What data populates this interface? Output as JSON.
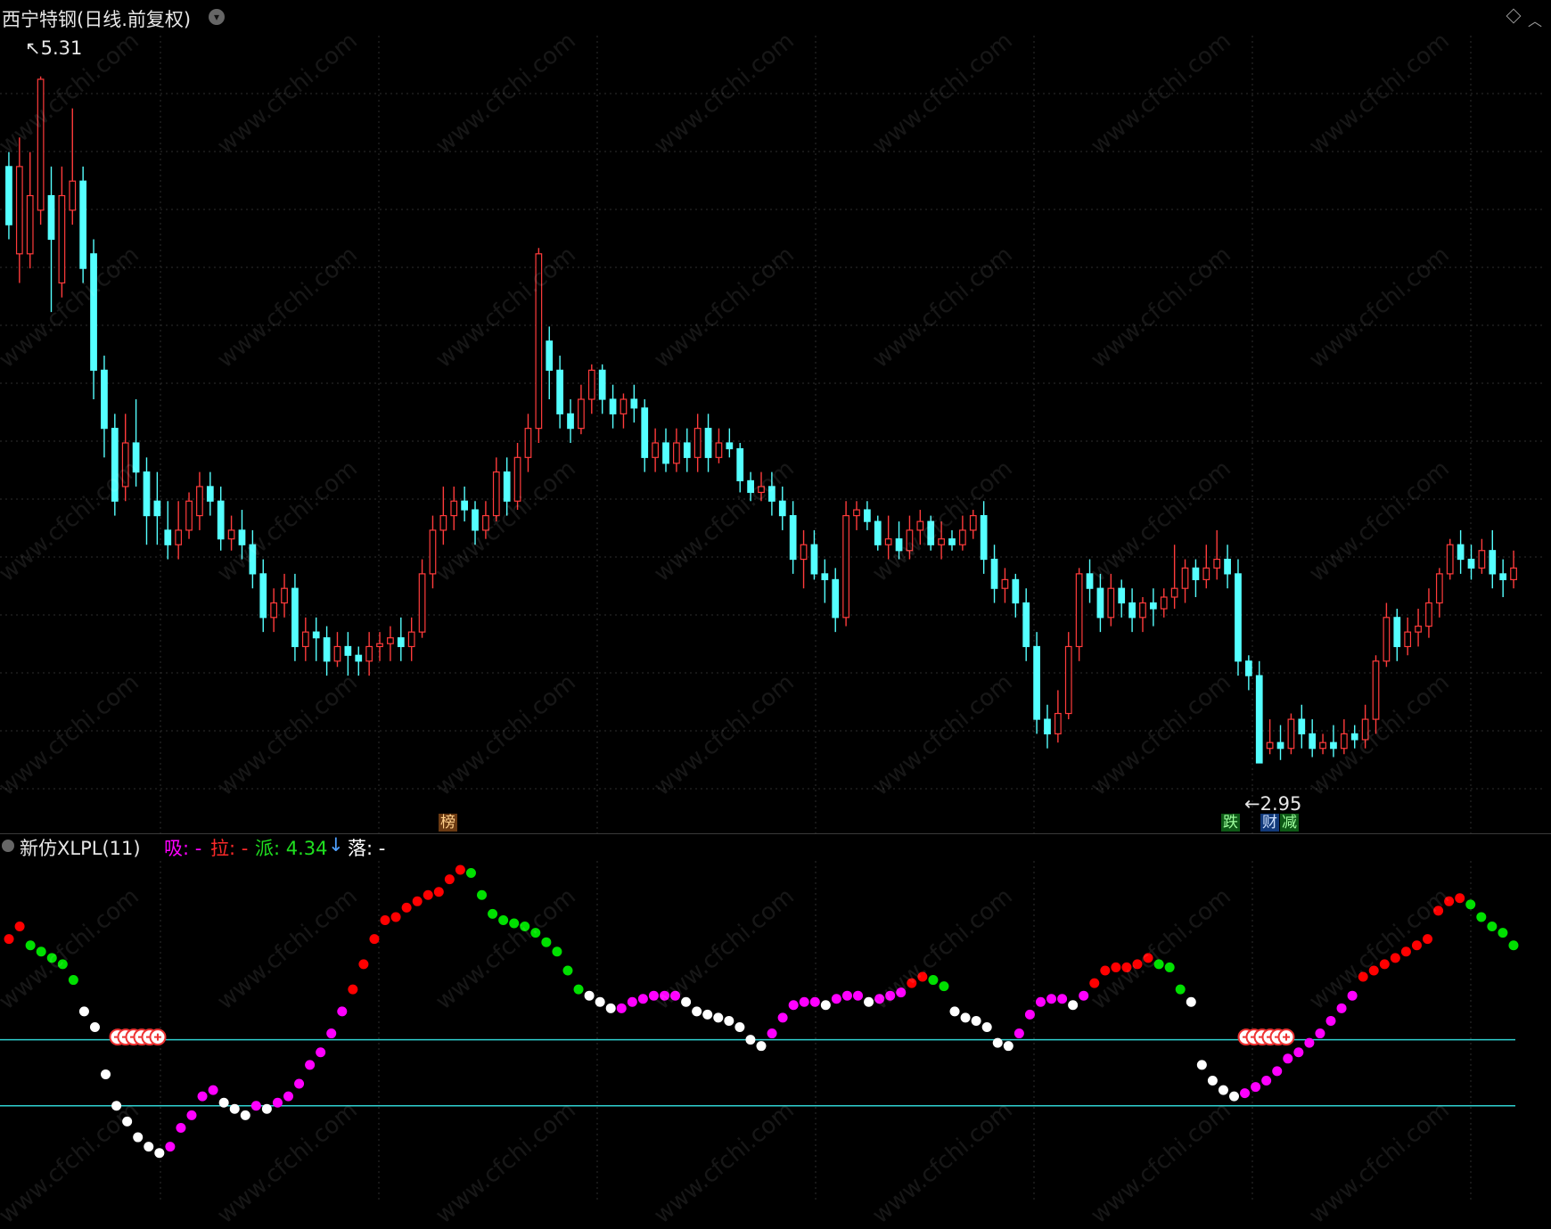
{
  "header": {
    "title": "西宁特钢(日线.前复权)"
  },
  "main_chart": {
    "high_label": "5.31",
    "low_label": "2.95",
    "tags": [
      {
        "text": "榜",
        "kind": "bang"
      },
      {
        "text": "跌",
        "kind": "die"
      },
      {
        "text": "财",
        "kind": "cai"
      },
      {
        "text": "减",
        "kind": "jian"
      }
    ],
    "watermark": "www.cfchi.com"
  },
  "indicator": {
    "name": "新仿XLPL(11)",
    "xi_label": "吸: -",
    "la_label": "拉: -",
    "pai_label": "派: 4.34",
    "pai_arrow": "↓",
    "luo_label": "落: -"
  },
  "colors": {
    "up": "#ff3b3b",
    "down": "#54ffff",
    "xi": "#ff00ff",
    "la": "#ff0000",
    "pai": "#00e000",
    "luo": "#ffffff",
    "grid": "#2e2e2e",
    "hline": "#2fd0d0"
  },
  "chart_data": {
    "type": "candlestick",
    "y_range": [
      2.8,
      5.45
    ],
    "candles": [
      [
        5.0,
        4.8,
        5.05,
        4.75
      ],
      [
        4.7,
        5.0,
        5.1,
        4.6
      ],
      [
        4.7,
        4.9,
        5.05,
        4.65
      ],
      [
        4.85,
        5.3,
        5.31,
        4.8
      ],
      [
        4.9,
        4.75,
        5.0,
        4.5
      ],
      [
        4.6,
        4.9,
        5.0,
        4.55
      ],
      [
        4.85,
        4.95,
        5.2,
        4.8
      ],
      [
        4.95,
        4.65,
        5.0,
        4.6
      ],
      [
        4.7,
        4.3,
        4.75,
        4.2
      ],
      [
        4.3,
        4.1,
        4.35,
        4.0
      ],
      [
        4.1,
        3.85,
        4.15,
        3.8
      ],
      [
        3.9,
        4.05,
        4.15,
        3.85
      ],
      [
        4.05,
        3.95,
        4.2,
        3.9
      ],
      [
        3.95,
        3.8,
        4.0,
        3.7
      ],
      [
        3.85,
        3.8,
        3.95,
        3.7
      ],
      [
        3.75,
        3.7,
        3.85,
        3.65
      ],
      [
        3.7,
        3.75,
        3.85,
        3.65
      ],
      [
        3.75,
        3.85,
        3.88,
        3.72
      ],
      [
        3.8,
        3.9,
        3.95,
        3.75
      ],
      [
        3.9,
        3.85,
        3.95,
        3.8
      ],
      [
        3.85,
        3.72,
        3.9,
        3.68
      ],
      [
        3.72,
        3.75,
        3.8,
        3.68
      ],
      [
        3.75,
        3.7,
        3.82,
        3.65
      ],
      [
        3.7,
        3.6,
        3.75,
        3.55
      ],
      [
        3.6,
        3.45,
        3.65,
        3.4
      ],
      [
        3.45,
        3.5,
        3.55,
        3.4
      ],
      [
        3.5,
        3.55,
        3.6,
        3.45
      ],
      [
        3.55,
        3.35,
        3.6,
        3.3
      ],
      [
        3.35,
        3.4,
        3.45,
        3.3
      ],
      [
        3.4,
        3.38,
        3.45,
        3.3
      ],
      [
        3.38,
        3.3,
        3.42,
        3.25
      ],
      [
        3.3,
        3.35,
        3.4,
        3.28
      ],
      [
        3.35,
        3.32,
        3.4,
        3.25
      ],
      [
        3.32,
        3.3,
        3.35,
        3.25
      ],
      [
        3.3,
        3.35,
        3.4,
        3.25
      ],
      [
        3.35,
        3.36,
        3.4,
        3.3
      ],
      [
        3.36,
        3.38,
        3.42,
        3.3
      ],
      [
        3.38,
        3.35,
        3.45,
        3.3
      ],
      [
        3.35,
        3.4,
        3.45,
        3.3
      ],
      [
        3.4,
        3.6,
        3.65,
        3.38
      ],
      [
        3.6,
        3.75,
        3.8,
        3.55
      ],
      [
        3.75,
        3.8,
        3.9,
        3.7
      ],
      [
        3.8,
        3.85,
        3.9,
        3.75
      ],
      [
        3.85,
        3.82,
        3.9,
        3.78
      ],
      [
        3.82,
        3.75,
        3.85,
        3.7
      ],
      [
        3.75,
        3.8,
        3.85,
        3.72
      ],
      [
        3.8,
        3.95,
        4.0,
        3.78
      ],
      [
        3.95,
        3.85,
        4.0,
        3.8
      ],
      [
        3.85,
        4.0,
        4.05,
        3.82
      ],
      [
        4.0,
        4.1,
        4.15,
        3.95
      ],
      [
        4.1,
        4.7,
        4.72,
        4.05
      ],
      [
        4.4,
        4.3,
        4.45,
        4.2
      ],
      [
        4.3,
        4.15,
        4.35,
        4.1
      ],
      [
        4.15,
        4.1,
        4.2,
        4.05
      ],
      [
        4.1,
        4.2,
        4.25,
        4.08
      ],
      [
        4.2,
        4.3,
        4.32,
        4.15
      ],
      [
        4.3,
        4.2,
        4.32,
        4.15
      ],
      [
        4.2,
        4.15,
        4.25,
        4.1
      ],
      [
        4.15,
        4.2,
        4.22,
        4.1
      ],
      [
        4.2,
        4.17,
        4.25,
        4.12
      ],
      [
        4.17,
        4.0,
        4.2,
        3.95
      ],
      [
        4.0,
        4.05,
        4.1,
        3.95
      ],
      [
        4.05,
        3.98,
        4.1,
        3.95
      ],
      [
        3.98,
        4.05,
        4.1,
        3.95
      ],
      [
        4.05,
        4.0,
        4.1,
        3.95
      ],
      [
        4.0,
        4.1,
        4.15,
        3.95
      ],
      [
        4.1,
        4.0,
        4.15,
        3.95
      ],
      [
        4.0,
        4.05,
        4.1,
        3.98
      ],
      [
        4.05,
        4.03,
        4.1,
        4.0
      ],
      [
        4.03,
        3.92,
        4.05,
        3.88
      ],
      [
        3.92,
        3.88,
        3.95,
        3.85
      ],
      [
        3.88,
        3.9,
        3.95,
        3.85
      ],
      [
        3.9,
        3.85,
        3.95,
        3.8
      ],
      [
        3.85,
        3.8,
        3.9,
        3.75
      ],
      [
        3.8,
        3.65,
        3.85,
        3.6
      ],
      [
        3.65,
        3.7,
        3.75,
        3.55
      ],
      [
        3.7,
        3.6,
        3.75,
        3.58
      ],
      [
        3.6,
        3.58,
        3.65,
        3.5
      ],
      [
        3.58,
        3.45,
        3.62,
        3.4
      ],
      [
        3.45,
        3.8,
        3.85,
        3.42
      ],
      [
        3.8,
        3.82,
        3.85,
        3.75
      ],
      [
        3.82,
        3.78,
        3.85,
        3.75
      ],
      [
        3.78,
        3.7,
        3.8,
        3.68
      ],
      [
        3.7,
        3.72,
        3.8,
        3.65
      ],
      [
        3.72,
        3.68,
        3.78,
        3.65
      ],
      [
        3.68,
        3.75,
        3.8,
        3.65
      ],
      [
        3.75,
        3.78,
        3.82,
        3.7
      ],
      [
        3.78,
        3.7,
        3.8,
        3.68
      ],
      [
        3.7,
        3.72,
        3.78,
        3.65
      ],
      [
        3.72,
        3.7,
        3.75,
        3.68
      ],
      [
        3.7,
        3.75,
        3.8,
        3.68
      ],
      [
        3.75,
        3.8,
        3.82,
        3.72
      ],
      [
        3.8,
        3.65,
        3.85,
        3.6
      ],
      [
        3.65,
        3.55,
        3.7,
        3.5
      ],
      [
        3.55,
        3.58,
        3.62,
        3.5
      ],
      [
        3.58,
        3.5,
        3.6,
        3.45
      ],
      [
        3.5,
        3.35,
        3.55,
        3.3
      ],
      [
        3.35,
        3.1,
        3.4,
        3.05
      ],
      [
        3.1,
        3.05,
        3.15,
        3.0
      ],
      [
        3.05,
        3.12,
        3.2,
        3.02
      ],
      [
        3.12,
        3.35,
        3.4,
        3.1
      ],
      [
        3.35,
        3.6,
        3.62,
        3.3
      ],
      [
        3.6,
        3.55,
        3.65,
        3.5
      ],
      [
        3.55,
        3.45,
        3.6,
        3.4
      ],
      [
        3.45,
        3.55,
        3.6,
        3.42
      ],
      [
        3.55,
        3.5,
        3.58,
        3.45
      ],
      [
        3.5,
        3.45,
        3.55,
        3.4
      ],
      [
        3.45,
        3.5,
        3.52,
        3.4
      ],
      [
        3.5,
        3.48,
        3.55,
        3.42
      ],
      [
        3.48,
        3.52,
        3.55,
        3.45
      ],
      [
        3.52,
        3.55,
        3.7,
        3.48
      ],
      [
        3.55,
        3.62,
        3.65,
        3.5
      ],
      [
        3.62,
        3.58,
        3.65,
        3.52
      ],
      [
        3.58,
        3.62,
        3.7,
        3.55
      ],
      [
        3.62,
        3.65,
        3.75,
        3.58
      ],
      [
        3.65,
        3.6,
        3.7,
        3.55
      ],
      [
        3.6,
        3.3,
        3.65,
        3.25
      ],
      [
        3.3,
        3.25,
        3.32,
        3.2
      ],
      [
        3.25,
        2.95,
        3.3,
        2.95
      ],
      [
        3.0,
        3.02,
        3.1,
        2.98
      ],
      [
        3.02,
        3.0,
        3.08,
        2.96
      ],
      [
        3.0,
        3.1,
        3.12,
        2.98
      ],
      [
        3.1,
        3.05,
        3.15,
        3.0
      ],
      [
        3.05,
        3.0,
        3.1,
        2.97
      ],
      [
        3.0,
        3.02,
        3.05,
        2.98
      ],
      [
        3.02,
        3.0,
        3.08,
        2.97
      ],
      [
        3.0,
        3.05,
        3.1,
        2.98
      ],
      [
        3.05,
        3.03,
        3.08,
        3.0
      ],
      [
        3.03,
        3.1,
        3.15,
        3.0
      ],
      [
        3.1,
        3.3,
        3.32,
        3.05
      ],
      [
        3.3,
        3.45,
        3.5,
        3.28
      ],
      [
        3.45,
        3.35,
        3.48,
        3.3
      ],
      [
        3.35,
        3.4,
        3.45,
        3.32
      ],
      [
        3.4,
        3.42,
        3.48,
        3.35
      ],
      [
        3.42,
        3.5,
        3.55,
        3.38
      ],
      [
        3.5,
        3.6,
        3.62,
        3.45
      ],
      [
        3.6,
        3.7,
        3.72,
        3.58
      ],
      [
        3.7,
        3.65,
        3.75,
        3.6
      ],
      [
        3.65,
        3.62,
        3.7,
        3.58
      ],
      [
        3.62,
        3.68,
        3.72,
        3.6
      ],
      [
        3.68,
        3.6,
        3.75,
        3.55
      ],
      [
        3.6,
        3.58,
        3.65,
        3.52
      ],
      [
        3.58,
        3.62,
        3.68,
        3.55
      ]
    ],
    "indicator_values": [
      0.78,
      0.82,
      0.76,
      0.74,
      0.72,
      0.7,
      0.65,
      0.55,
      0.5,
      0.35,
      0.25,
      0.2,
      0.15,
      0.12,
      0.1,
      0.12,
      0.18,
      0.22,
      0.28,
      0.3,
      0.26,
      0.24,
      0.22,
      0.25,
      0.24,
      0.26,
      0.28,
      0.32,
      0.38,
      0.42,
      0.48,
      0.55,
      0.62,
      0.7,
      0.78,
      0.84,
      0.85,
      0.88,
      0.9,
      0.92,
      0.93,
      0.97,
      1.0,
      0.99,
      0.92,
      0.86,
      0.84,
      0.83,
      0.82,
      0.8,
      0.77,
      0.74,
      0.68,
      0.62,
      0.6,
      0.58,
      0.56,
      0.56,
      0.58,
      0.59,
      0.6,
      0.6,
      0.6,
      0.58,
      0.55,
      0.54,
      0.53,
      0.52,
      0.5,
      0.46,
      0.44,
      0.48,
      0.53,
      0.57,
      0.58,
      0.58,
      0.57,
      0.59,
      0.6,
      0.6,
      0.58,
      0.59,
      0.6,
      0.61,
      0.64,
      0.66,
      0.65,
      0.63,
      0.55,
      0.53,
      0.52,
      0.5,
      0.45,
      0.44,
      0.48,
      0.54,
      0.58,
      0.59,
      0.59,
      0.57,
      0.6,
      0.64,
      0.68,
      0.69,
      0.69,
      0.7,
      0.72,
      0.7,
      0.69,
      0.62,
      0.58,
      0.38,
      0.33,
      0.3,
      0.28,
      0.29,
      0.31,
      0.33,
      0.36,
      0.4,
      0.42,
      0.45,
      0.48,
      0.52,
      0.56,
      0.6,
      0.66,
      0.68,
      0.7,
      0.72,
      0.74,
      0.76,
      0.78,
      0.87,
      0.9,
      0.91,
      0.89,
      0.85,
      0.82,
      0.8,
      0.76
    ],
    "hlines": [
      0.46,
      0.25
    ]
  }
}
